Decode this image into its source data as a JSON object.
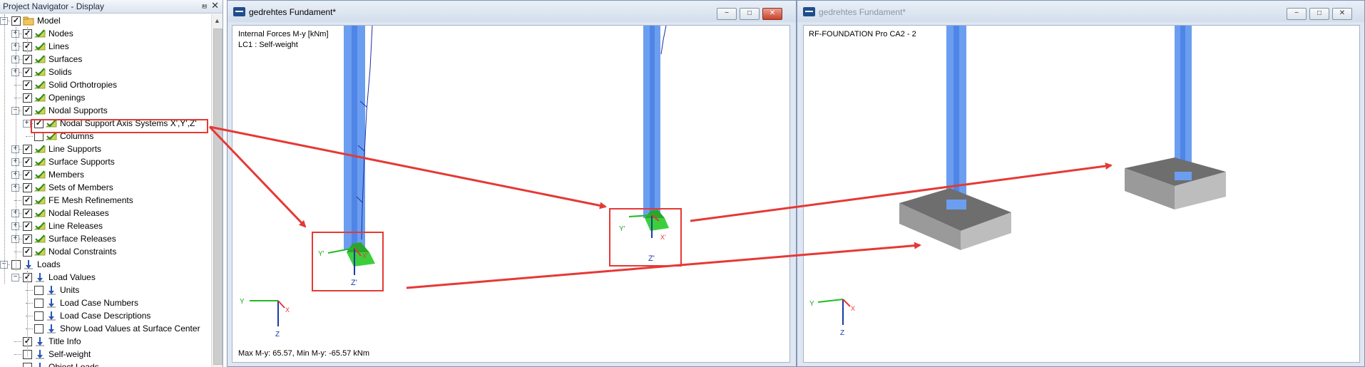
{
  "navigator": {
    "title": "Project Navigator - Display",
    "pin_glyph": "⩏",
    "close_glyph": "✕",
    "items": [
      {
        "label": "Model",
        "checked": true,
        "icon": "folder-check-icon"
      },
      {
        "label": "Nodes",
        "checked": true,
        "icon": "display-icon"
      },
      {
        "label": "Lines",
        "checked": true,
        "icon": "display-icon"
      },
      {
        "label": "Surfaces",
        "checked": true,
        "icon": "display-icon"
      },
      {
        "label": "Solids",
        "checked": true,
        "icon": "display-icon"
      },
      {
        "label": "Solid Orthotropies",
        "checked": true,
        "icon": "display-icon"
      },
      {
        "label": "Openings",
        "checked": true,
        "icon": "display-icon"
      },
      {
        "label": "Nodal Supports",
        "checked": true,
        "icon": "display-icon"
      },
      {
        "label": "Nodal Support Axis Systems X',Y',Z'",
        "checked": true,
        "icon": "display-icon"
      },
      {
        "label": "Columns",
        "checked": false,
        "icon": "display-icon"
      },
      {
        "label": "Line Supports",
        "checked": true,
        "icon": "display-icon"
      },
      {
        "label": "Surface Supports",
        "checked": true,
        "icon": "display-icon"
      },
      {
        "label": "Members",
        "checked": true,
        "icon": "display-icon"
      },
      {
        "label": "Sets of Members",
        "checked": true,
        "icon": "display-icon"
      },
      {
        "label": "FE Mesh Refinements",
        "checked": true,
        "icon": "display-icon"
      },
      {
        "label": "Nodal Releases",
        "checked": true,
        "icon": "display-icon"
      },
      {
        "label": "Line Releases",
        "checked": true,
        "icon": "display-icon"
      },
      {
        "label": "Surface Releases",
        "checked": true,
        "icon": "display-icon"
      },
      {
        "label": "Nodal Constraints",
        "checked": true,
        "icon": "display-icon"
      },
      {
        "label": "Loads",
        "checked": false,
        "icon": "load-arrow-icon"
      },
      {
        "label": "Load Values",
        "checked": true,
        "icon": "load-arrow-icon"
      },
      {
        "label": "Units",
        "checked": false,
        "icon": "load-arrow-icon"
      },
      {
        "label": "Load Case Numbers",
        "checked": false,
        "icon": "load-arrow-icon"
      },
      {
        "label": "Load Case Descriptions",
        "checked": false,
        "icon": "load-arrow-icon"
      },
      {
        "label": "Show Load Values at Surface Center",
        "checked": false,
        "icon": "load-arrow-icon"
      },
      {
        "label": "Title Info",
        "checked": true,
        "icon": "load-arrow-icon"
      },
      {
        "label": "Self-weight",
        "checked": false,
        "icon": "load-arrow-icon"
      },
      {
        "label": "Object Loads",
        "checked": false,
        "icon": "load-arrow-icon"
      }
    ]
  },
  "window1": {
    "title": "gedrehtes Fundament*",
    "minimize": "−",
    "maximize": "□",
    "close": "✕",
    "result_label": "Internal Forces M-y [kNm]",
    "load_case": "LC1 : Self-weight",
    "footer": "Max M-y: 65.57, Min M-y: -65.57 kNm",
    "axis_labels": {
      "y_local": "Y'",
      "z_local": "Z'",
      "x_local": "X'",
      "y": "Y",
      "z": "Z",
      "x": "X"
    }
  },
  "window2": {
    "title": "gedrehtes Fundament*",
    "minimize": "−",
    "maximize": "□",
    "close": "✕",
    "result_label": "RF-FOUNDATION Pro CA2 - 2",
    "axis_labels": {
      "y": "Y",
      "z": "Z",
      "x": "X"
    }
  },
  "colors": {
    "column_blue": "#6b9ef0",
    "support_green": "#3ccf3c",
    "highlight_red": "#e53935",
    "foundation_top": "#6e6e6e",
    "foundation_side": "#bdbdbd"
  }
}
